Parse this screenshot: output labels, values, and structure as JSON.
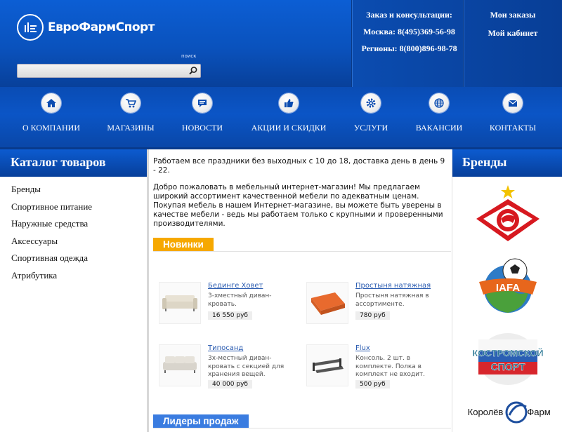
{
  "header": {
    "logo_text": "ЕвроФармСпорт",
    "search_label": "поиск",
    "search_placeholder": "",
    "contacts": [
      "Заказ и консультации:",
      "Москва: 8(495)369-56-98",
      "Регионы: 8(800)896-98-78"
    ],
    "account": [
      "Мои заказы",
      "Мой кабинет"
    ]
  },
  "nav": [
    {
      "label": "О КОМПАНИИ",
      "icon": "home-icon"
    },
    {
      "label": "МАГАЗИНЫ",
      "icon": "cart-icon"
    },
    {
      "label": "НОВОСТИ",
      "icon": "chat-icon"
    },
    {
      "label": "АКЦИИ И СКИДКИ",
      "icon": "thumbs-up-icon"
    },
    {
      "label": "УСЛУГИ",
      "icon": "gear-icon"
    },
    {
      "label": "ВАКАНСИИ",
      "icon": "globe-icon"
    },
    {
      "label": "КОНТАКТЫ",
      "icon": "mail-icon"
    }
  ],
  "catalog": {
    "title": "Каталог товаров",
    "items": [
      "Бренды",
      "Спортивное питание",
      "Наружные средства",
      "Аксессуары",
      "Спортивная одежда",
      "Атрибутика"
    ]
  },
  "main": {
    "intro1": "Работаем все праздники без выходных с 10 до 18, доставка день в день 9 - 22.",
    "intro2": "Добро пожаловать в мебельный интернет-магазин! Мы предлагаем широкий ассортимент качественной мебели по адекватным ценам. Покупая мебель в нашем Интернет-магазине, вы можете быть уверены в качестве мебели - ведь мы работаем только с крупными и проверенными производителями.",
    "new_section": "Новинки",
    "leaders_section": "Лидеры продаж",
    "products": [
      {
        "name": "Бединге Ховет",
        "desc": "3-хместный диван-кровать.",
        "price": "16 550 руб"
      },
      {
        "name": "Простыня натяжная",
        "desc": "Простыня натяжная в ассортименте.",
        "price": "780 руб"
      },
      {
        "name": "Типосанд",
        "desc": "3х-местный диван-кровать с секцией для хранения вещей.",
        "price": "40 000 руб"
      },
      {
        "name": "Flux",
        "desc": "Консоль. 2 шт. в комплекте. Полка в комплект не входит.",
        "price": "500 руб"
      }
    ]
  },
  "brands": {
    "title": "Бренды",
    "logos": [
      {
        "name": "spartak-logo"
      },
      {
        "name": "iafa-logo",
        "text": "IAFA"
      },
      {
        "name": "kostromskoy-sport-logo",
        "text": [
          "КОСТРОМСКОЙ",
          "СПОРТ"
        ]
      },
      {
        "name": "korolev-farm-logo",
        "text": [
          "Королёв",
          "Фарм"
        ]
      }
    ]
  },
  "colors": {
    "header_blue": "#0a52bd",
    "accent_orange": "#f6a800",
    "accent_blue": "#3a7ce0",
    "link": "#2a5bb0"
  }
}
